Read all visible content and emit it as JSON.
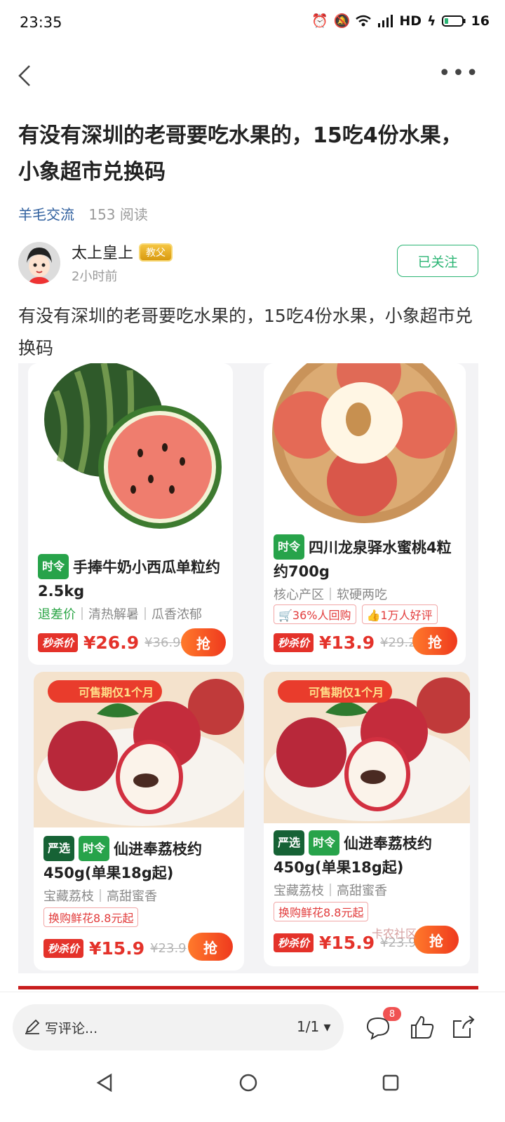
{
  "status_bar": {
    "time": "23:35",
    "indicators": "HD",
    "battery": "16"
  },
  "post": {
    "title": "有没有深圳的老哥要吃水果的，15吃4份水果，小象超市兑换码",
    "category": "羊毛交流",
    "reads": "153 阅读",
    "author": {
      "name": "太上皇上",
      "badge": "教父",
      "time_ago": "2小时前"
    },
    "follow_label": "已关注",
    "body": "有没有深圳的老哥要吃水果的，15吃4份水果，小象超市兑换码"
  },
  "products": [
    {
      "tag1": "时令",
      "name": "手捧牛奶小西瓜单粒约2.5kg",
      "sub_green": "退差价",
      "sub_rest": "｜清热解暑｜瓜香浓郁",
      "flash": "秒杀价",
      "price": "¥26.9",
      "orig": "¥36.9",
      "buy": "抢"
    },
    {
      "tag1": "时令",
      "name": "四川龙泉驿水蜜桃4粒约700g",
      "sub": "核心产区｜软硬两吃",
      "chip1": "36%人回购",
      "chip2": "1万人好评",
      "flash": "秒杀价",
      "price": "¥13.9",
      "orig": "¥29.2",
      "buy": "抢"
    },
    {
      "banner": "可售期仅1个月",
      "tag0": "严选",
      "tag1": "时令",
      "name": "仙进奉荔枝约450g(单果18g起)",
      "sub": "宝藏荔枝｜高甜蜜香",
      "chip1": "换购鲜花8.8元起",
      "flash": "秒杀价",
      "price": "¥15.9",
      "orig": "¥23.9",
      "buy": "抢"
    },
    {
      "banner": "可售期仅1个月",
      "tag0": "严选",
      "tag1": "时令",
      "name": "仙进奉荔枝约450g(单果18g起)",
      "sub": "宝藏荔枝｜高甜蜜香",
      "chip1": "换购鲜花8.8元起",
      "flash": "秒杀价",
      "price": "¥15.9",
      "orig": "¥23.9",
      "buy": "抢"
    }
  ],
  "watermark": "卡农社区",
  "bottom": {
    "comment_placeholder": "写评论...",
    "page": "1/1",
    "comment_count": "8"
  },
  "colors": {
    "accent_green": "#2bb574",
    "price_red": "#e4322a"
  }
}
